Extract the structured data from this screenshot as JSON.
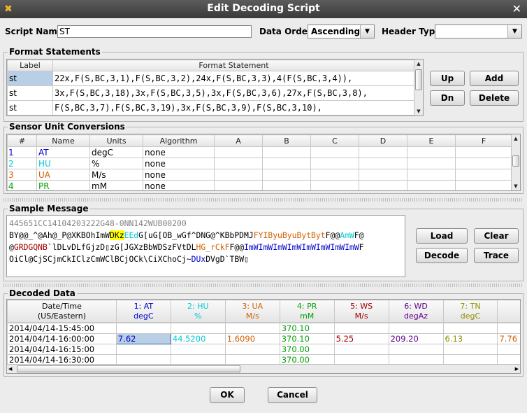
{
  "window": {
    "title": "Edit Decoding Script"
  },
  "script": {
    "name_label": "Script Name:",
    "name_value": "ST",
    "order_label": "Data Order:",
    "order_value": "Ascending",
    "header_label": "Header Type",
    "header_value": ""
  },
  "format": {
    "title": "Format Statements",
    "headers": [
      "Label",
      "Format Statement"
    ],
    "rows": [
      {
        "label": "st",
        "stmt": "22x,F(S,BC,3,1),F(S,BC,3,2),24x,F(S,BC,3,3),4(F(S,BC,3,4)),"
      },
      {
        "label": "st",
        "stmt": "3x,F(S,BC,3,18),3x,F(S,BC,3,5),3x,F(S,BC,3,6),27x,F(S,BC,3,8),"
      },
      {
        "label": "st",
        "stmt": "F(S,BC,3,7),F(S,BC,3,19),3x,F(S,BC,3,9),F(S,BC,3,10),"
      }
    ],
    "buttons": {
      "up": "Up",
      "dn": "Dn",
      "add": "Add",
      "delete": "Delete"
    }
  },
  "sensor": {
    "title": "Sensor Unit Conversions",
    "headers": [
      "#",
      "Name",
      "Units",
      "Algorithm",
      "A",
      "B",
      "C",
      "D",
      "E",
      "F"
    ],
    "rows": [
      {
        "num": "1",
        "name": "AT",
        "units": "degC",
        "alg": "none",
        "color": "#0000cc"
      },
      {
        "num": "2",
        "name": "HU",
        "units": "%",
        "alg": "none",
        "color": "#00c8d8"
      },
      {
        "num": "3",
        "name": "UA",
        "units": "M/s",
        "alg": "none",
        "color": "#d06000"
      },
      {
        "num": "4",
        "name": "PR",
        "units": "mM",
        "alg": "none",
        "color": "#00a000"
      }
    ]
  },
  "sample": {
    "title": "Sample Message",
    "header_line": "445651CC14104203222G48-0NN142WUB00200",
    "line1": [
      {
        "t": "BY@@_^@Ah@_P@XKBOhImW",
        "c": "#000"
      },
      {
        "t": "DKz",
        "c": "#000",
        "bg": "#ffff00"
      },
      {
        "t": "EEd",
        "c": "#00c8d8"
      },
      {
        "t": "G[uG[OB_wGf^DNG@^KBbPDMJ",
        "c": "#000"
      },
      {
        "t": "FYIByuByuBytByt",
        "c": "#d06000"
      },
      {
        "t": "F@@",
        "c": "#000"
      },
      {
        "t": "AmW",
        "c": "#00c8d8"
      },
      {
        "t": "F@",
        "c": "#000"
      }
    ],
    "line2": [
      {
        "t": "@",
        "c": "#000"
      },
      {
        "t": "GRDGQNB",
        "c": "#a00000"
      },
      {
        "t": "`lDLvDLfGjzD▯zG[JGXzBbWDSzFVtDL",
        "c": "#000"
      },
      {
        "t": "HG_rCkF",
        "c": "#d06000"
      },
      {
        "t": "F@@",
        "c": "#000"
      },
      {
        "t": "ImWImWImWImWImWImWImWImW",
        "c": "#0000cc"
      },
      {
        "t": "F",
        "c": "#000"
      }
    ],
    "line3": [
      {
        "t": "OiCl@CjSCjmCkIClzCmWClBCjOCk\\CiXChoCj~",
        "c": "#000"
      },
      {
        "t": "DUx",
        "c": "#0000cc"
      },
      {
        "t": "DVgD`TBW▯",
        "c": "#000"
      }
    ],
    "buttons": {
      "load": "Load",
      "clear": "Clear",
      "decode": "Decode",
      "trace": "Trace"
    }
  },
  "decoded": {
    "title": "Decoded Data",
    "headers": [
      {
        "l1": "Date/Time",
        "l2": "(US/Eastern)",
        "c": "#000"
      },
      {
        "l1": "1: AT",
        "l2": "degC",
        "c": "#0000cc"
      },
      {
        "l1": "2: HU",
        "l2": "%",
        "c": "#00c8d8"
      },
      {
        "l1": "3: UA",
        "l2": "M/s",
        "c": "#d06000"
      },
      {
        "l1": "4: PR",
        "l2": "mM",
        "c": "#00a000"
      },
      {
        "l1": "5: WS",
        "l2": "M/s",
        "c": "#a00000"
      },
      {
        "l1": "6: WD",
        "l2": "degAz",
        "c": "#600090"
      },
      {
        "l1": "7: TN",
        "l2": "degC",
        "c": "#909000"
      },
      {
        "l1": "8:",
        "l2": "de",
        "c": "#d06000"
      }
    ],
    "rows": [
      [
        "2014/04/14-15:45:00",
        "",
        "",
        "",
        "370.10",
        "",
        "",
        "",
        ""
      ],
      [
        "2014/04/14-16:00:00",
        "7.62",
        "44.5200",
        "1.6090",
        "370.10",
        "5.25",
        "209.20",
        "6.13",
        "7.76"
      ],
      [
        "2014/04/14-16:15:00",
        "",
        "",
        "",
        "370.00",
        "",
        "",
        "",
        ""
      ],
      [
        "2014/04/14-16:30:00",
        "",
        "",
        "",
        "370.00",
        "",
        "",
        "",
        ""
      ]
    ]
  },
  "footer": {
    "ok": "OK",
    "cancel": "Cancel"
  }
}
